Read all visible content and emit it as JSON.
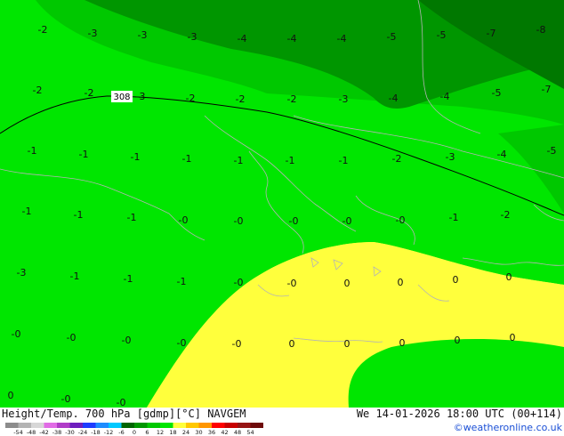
{
  "title": "Height/Temp. 700 hPa [gdmp][°C] NAVGEM",
  "valid": "We 14-01-2026 18:00 UTC (00+114)",
  "credit": "©weatheronline.co.uk",
  "contour_label": "308",
  "temperature_labels": [
    "-2",
    "-3",
    "-3",
    "-3",
    "-4",
    "-4",
    "-4",
    "-5",
    "-5",
    "-7",
    "-8",
    "-2",
    "-2",
    "-3",
    "-2",
    "-2",
    "-2",
    "-3",
    "-4",
    "-4",
    "-5",
    "-7",
    "-1",
    "-1",
    "-1",
    "-1",
    "-1",
    "-1",
    "-1",
    "-2",
    "-3",
    "-4",
    "-5",
    "-1",
    "-1",
    "-1",
    "-0",
    "-0",
    "-0",
    "-0",
    "-0",
    "-1",
    "-2",
    "-3",
    "-1",
    "-1",
    "-1",
    "-0",
    "-0",
    "0",
    "0",
    "0",
    "0",
    "-0",
    "-0",
    "-0",
    "-0",
    "-0",
    "0",
    "0",
    "0",
    "0",
    "0",
    "0",
    "-0",
    "-0",
    "-0"
  ],
  "legend": {
    "tick_labels": [
      "-54",
      "-48",
      "-42",
      "-38",
      "-30",
      "-24",
      "-18",
      "-12",
      "-6",
      "0",
      "6",
      "12",
      "18",
      "24",
      "30",
      "36",
      "42",
      "48",
      "54"
    ],
    "colors": [
      "#8c8c8c",
      "#b4b4b4",
      "#d7d7d7",
      "#e16ce6",
      "#b03cc8",
      "#6e1ebe",
      "#1e3cff",
      "#1e8cff",
      "#00c8ff",
      "#006400",
      "#009600",
      "#00c800",
      "#00e600",
      "#ffff3c",
      "#ffc800",
      "#ff9600",
      "#ff0000",
      "#c80000",
      "#961414",
      "#6e0a0a"
    ]
  },
  "colors": {
    "lightgreen": "#00e600",
    "green": "#00c800",
    "darkgreen": "#009600",
    "yellow": "#ffff3c"
  }
}
